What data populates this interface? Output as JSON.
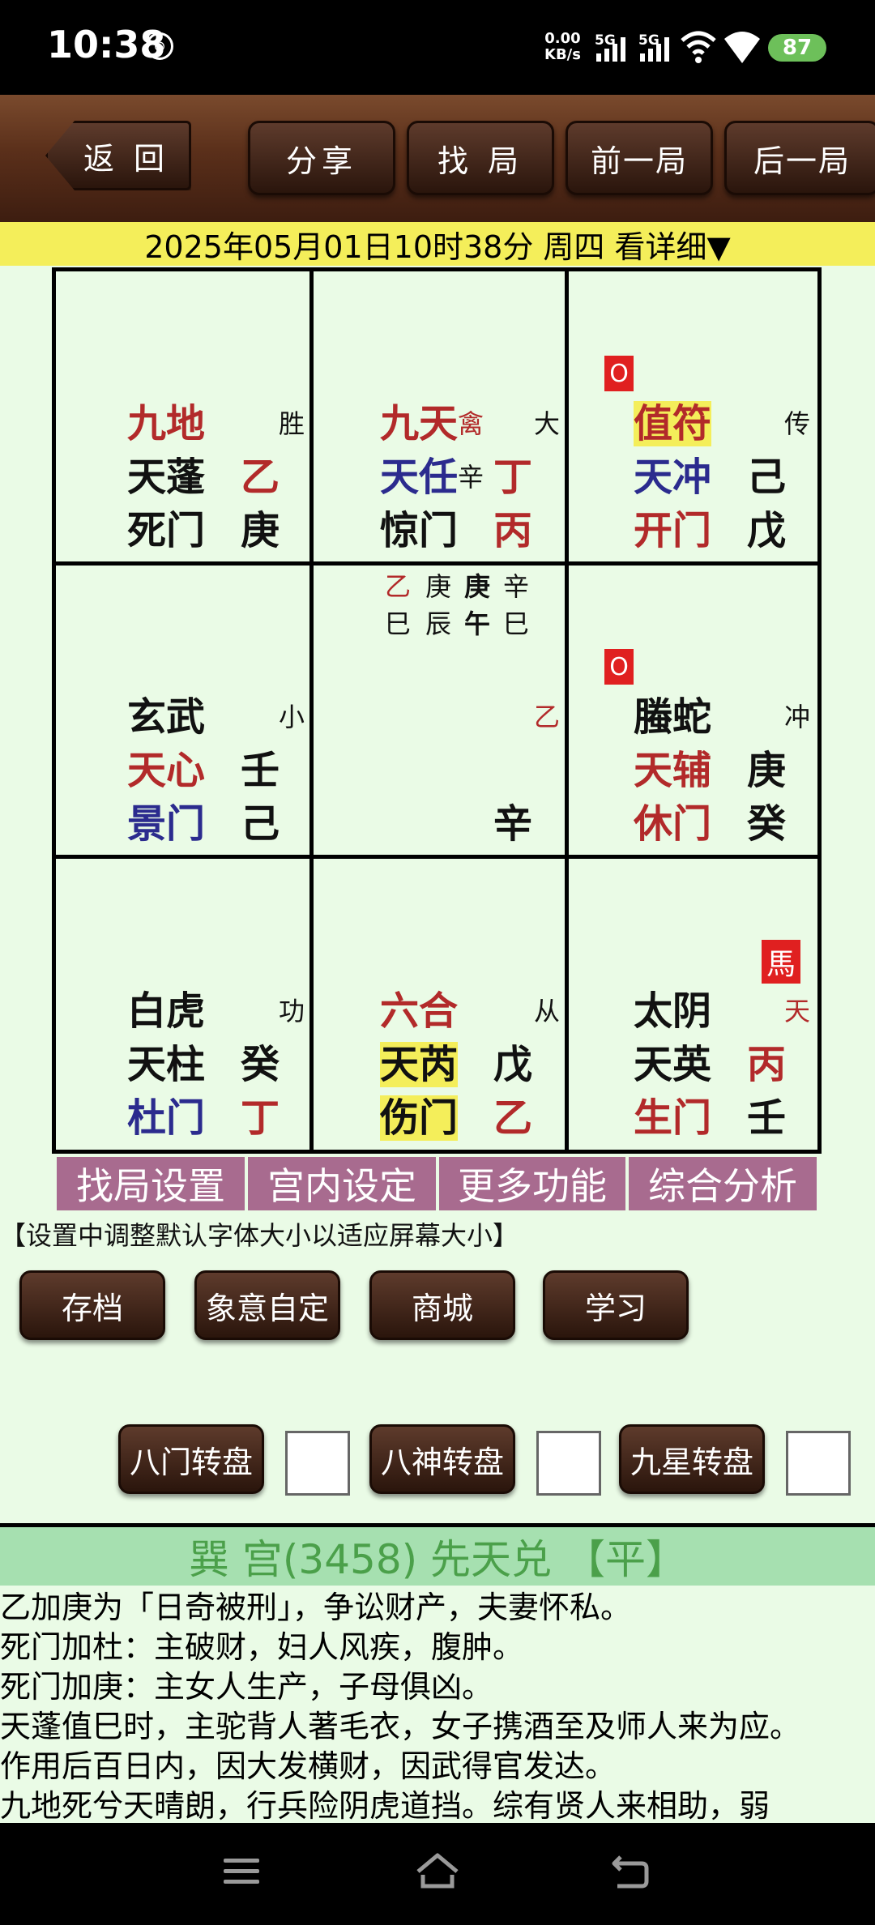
{
  "status": {
    "time": "10:38",
    "badge": "⊕",
    "net_speed_value": "0.00",
    "net_speed_unit": "KB/s",
    "sig1": "5G",
    "sig2": "5G",
    "battery": "87"
  },
  "toolbar": {
    "back": "返 回",
    "share": "分享",
    "find": "找 局",
    "prev": "前一局",
    "next": "后一局"
  },
  "date_line": "2025年05月01日10时38分 周四 看详细▼",
  "grid": {
    "c00": {
      "god": "九地",
      "tag": "胜",
      "star": "天蓬",
      "stem1": "乙",
      "door": "死门",
      "stem2": "庚"
    },
    "c01": {
      "god": "九天",
      "god_extra": "禽",
      "tag": "大",
      "star": "天任",
      "star_extra": "辛",
      "stem1": "丁",
      "door": "惊门",
      "stem2": "丙"
    },
    "c02": {
      "badge": "O",
      "god": "值符",
      "tag": "传",
      "star": "天冲",
      "stem1": "己",
      "door": "开门",
      "stem2": "戊"
    },
    "c10": {
      "god": "玄武",
      "tag": "小",
      "star": "天心",
      "stem1": "壬",
      "door": "景门",
      "stem2": "己"
    },
    "c11": {
      "pillars_top": [
        "乙",
        "庚",
        "庚",
        "辛"
      ],
      "pillars_bottom": [
        "巳",
        "辰",
        "午",
        "巳"
      ],
      "side": "乙",
      "bottom": "辛"
    },
    "c12": {
      "badge": "O",
      "god": "螣蛇",
      "tag": "冲",
      "star": "天辅",
      "stem1": "庚",
      "door": "休门",
      "stem2": "癸"
    },
    "c20": {
      "god": "白虎",
      "tag": "功",
      "star": "天柱",
      "stem1": "癸",
      "door": "杜门",
      "stem2": "丁"
    },
    "c21": {
      "god": "六合",
      "tag": "从",
      "star": "天芮",
      "stem1": "戊",
      "door": "伤门",
      "stem2": "乙"
    },
    "c22": {
      "badge": "馬",
      "god": "太阴",
      "tag": "天",
      "star": "天英",
      "stem1": "丙",
      "door": "生门",
      "stem2": "壬"
    }
  },
  "tabs": [
    "找局设置",
    "宫内设定",
    "更多功能",
    "综合分析"
  ],
  "hint": "【设置中调整默认字体大小以适应屏幕大小】",
  "actions": [
    "存档",
    "象意自定",
    "商城",
    "学习"
  ],
  "rotations": [
    "八门转盘",
    "八神转盘",
    "九星转盘"
  ],
  "palace_title": "巽 宫(3458) 先天兑 【平】",
  "description": [
    "乙加庚为「日奇被刑」，争讼财产，夫妻怀私。",
    "死门加杜：主破财，妇人风疾，腹肿。",
    "死门加庚：主女人生产，子母俱凶。",
    "天蓬值巳时，主驼背人著毛衣，女子携酒至及师人来为应。",
    "作用后百日内，因大发横财，因武得官发达。",
    "九地死兮天晴朗，行兵险阴虎道挡。综有贤人来相助，弱"
  ]
}
